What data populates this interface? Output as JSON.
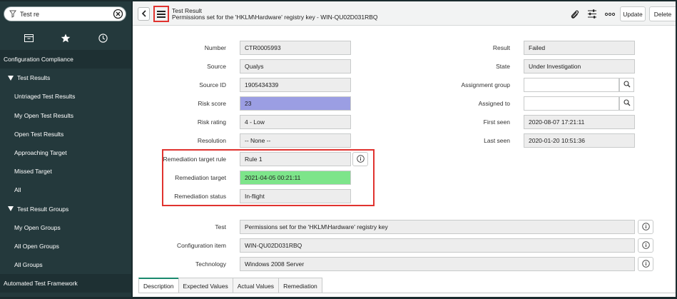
{
  "sidebar": {
    "filter_value": "Test re",
    "items": [
      {
        "label": "Configuration Compliance",
        "kind": "section"
      },
      {
        "label": "Test Results",
        "kind": "group"
      },
      {
        "label": "Untriaged Test Results",
        "kind": "leaf"
      },
      {
        "label": "My Open Test Results",
        "kind": "leaf"
      },
      {
        "label": "Open Test Results",
        "kind": "leaf"
      },
      {
        "label": "Approaching Target",
        "kind": "leaf"
      },
      {
        "label": "Missed Target",
        "kind": "leaf"
      },
      {
        "label": "All",
        "kind": "leaf"
      },
      {
        "label": "Test Result Groups",
        "kind": "group"
      },
      {
        "label": "My Open Groups",
        "kind": "leaf"
      },
      {
        "label": "All Open Groups",
        "kind": "leaf"
      },
      {
        "label": "All Groups",
        "kind": "leaf"
      }
    ],
    "bottom_section": "Automated Test Framework",
    "tab_icons": [
      "archive-icon",
      "star-icon",
      "clock-icon"
    ]
  },
  "header": {
    "title": "Test Result",
    "subtitle": "Permissions set for the 'HKLM\\Hardware' registry key - WIN-QU02D031RBQ",
    "update_label": "Update",
    "delete_label": "Delete"
  },
  "form": {
    "left": [
      {
        "label": "Number",
        "value": "CTR0005993"
      },
      {
        "label": "Source",
        "value": "Qualys"
      },
      {
        "label": "Source ID",
        "value": "1905434339"
      },
      {
        "label": "Risk score",
        "value": "23"
      },
      {
        "label": "Risk rating",
        "value": "4 - Low"
      },
      {
        "label": "Resolution",
        "value": "-- None --"
      },
      {
        "label": "Remediation target rule",
        "value": "Rule 1"
      },
      {
        "label": "Remediation target",
        "value": "2021-04-05 00:21:11"
      },
      {
        "label": "Remediation status",
        "value": "In-flight"
      }
    ],
    "right": [
      {
        "label": "Result",
        "value": "Failed"
      },
      {
        "label": "State",
        "value": "Under Investigation"
      },
      {
        "label": "Assignment group",
        "value": ""
      },
      {
        "label": "Assigned to",
        "value": ""
      },
      {
        "label": "First seen",
        "value": "2020-08-07 17:21:11"
      },
      {
        "label": "Last seen",
        "value": "2020-01-20 10:51:36"
      }
    ],
    "wide": [
      {
        "label": "Test",
        "value": "Permissions set for the 'HKLM\\Hardware'  registry key"
      },
      {
        "label": "Configuration item",
        "value": "WIN-QU02D031RBQ"
      },
      {
        "label": "Technology",
        "value": "Windows 2008 Server"
      }
    ]
  },
  "tabs": [
    "Description",
    "Expected Values",
    "Actual Values",
    "Remediation"
  ],
  "colors": {
    "risk_score_fill": "#9b9ee3",
    "remediation_target_fill": "#7de58a",
    "highlight": "#e0332f",
    "sidebar_bg": "#24393c"
  }
}
